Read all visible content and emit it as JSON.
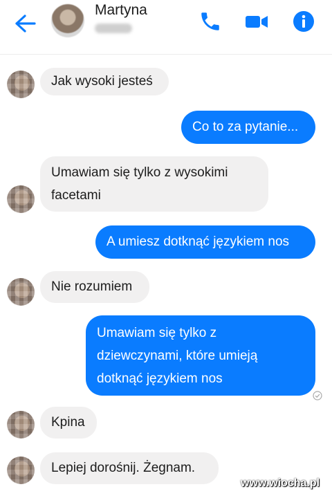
{
  "header": {
    "contact_name": "Martyna",
    "icons": [
      "back-arrow-icon",
      "phone-icon",
      "video-camera-icon",
      "info-icon"
    ],
    "accent": "#0a7cff"
  },
  "messages": [
    {
      "from": "them",
      "text": "Jak wysoki jesteś"
    },
    {
      "from": "me",
      "text": "Co to za pytanie..."
    },
    {
      "from": "them",
      "lines": [
        "Umawiam się tylko z wysokimi",
        "facetami"
      ]
    },
    {
      "from": "me",
      "text": "A umiesz dotknąć językiem nos"
    },
    {
      "from": "them",
      "text": "Nie rozumiem"
    },
    {
      "from": "me",
      "lines": [
        "Umawiam się tylko z",
        "dziewczynami, które umieją",
        "dotknąć językiem nos"
      ]
    },
    {
      "from": "them",
      "text": "Kpina"
    },
    {
      "from": "them",
      "text": "Lepiej dorośnij. Żegnam."
    }
  ],
  "colors": {
    "incoming_bubble": "#f1f0f0",
    "outgoing_bubble": "#0a7cff"
  },
  "watermark": "www.wiocha.pl"
}
